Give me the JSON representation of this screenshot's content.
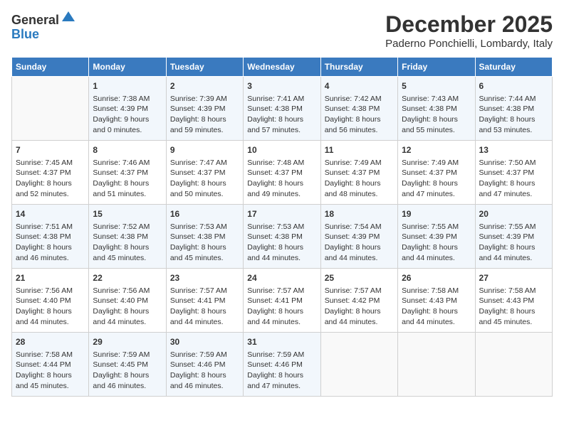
{
  "header": {
    "logo_line1": "General",
    "logo_line2": "Blue",
    "month_title": "December 2025",
    "subtitle": "Paderno Ponchielli, Lombardy, Italy"
  },
  "weekdays": [
    "Sunday",
    "Monday",
    "Tuesday",
    "Wednesday",
    "Thursday",
    "Friday",
    "Saturday"
  ],
  "weeks": [
    [
      {
        "day": "",
        "content": ""
      },
      {
        "day": "1",
        "content": "Sunrise: 7:38 AM\nSunset: 4:39 PM\nDaylight: 9 hours\nand 0 minutes."
      },
      {
        "day": "2",
        "content": "Sunrise: 7:39 AM\nSunset: 4:39 PM\nDaylight: 8 hours\nand 59 minutes."
      },
      {
        "day": "3",
        "content": "Sunrise: 7:41 AM\nSunset: 4:38 PM\nDaylight: 8 hours\nand 57 minutes."
      },
      {
        "day": "4",
        "content": "Sunrise: 7:42 AM\nSunset: 4:38 PM\nDaylight: 8 hours\nand 56 minutes."
      },
      {
        "day": "5",
        "content": "Sunrise: 7:43 AM\nSunset: 4:38 PM\nDaylight: 8 hours\nand 55 minutes."
      },
      {
        "day": "6",
        "content": "Sunrise: 7:44 AM\nSunset: 4:38 PM\nDaylight: 8 hours\nand 53 minutes."
      }
    ],
    [
      {
        "day": "7",
        "content": "Sunrise: 7:45 AM\nSunset: 4:37 PM\nDaylight: 8 hours\nand 52 minutes."
      },
      {
        "day": "8",
        "content": "Sunrise: 7:46 AM\nSunset: 4:37 PM\nDaylight: 8 hours\nand 51 minutes."
      },
      {
        "day": "9",
        "content": "Sunrise: 7:47 AM\nSunset: 4:37 PM\nDaylight: 8 hours\nand 50 minutes."
      },
      {
        "day": "10",
        "content": "Sunrise: 7:48 AM\nSunset: 4:37 PM\nDaylight: 8 hours\nand 49 minutes."
      },
      {
        "day": "11",
        "content": "Sunrise: 7:49 AM\nSunset: 4:37 PM\nDaylight: 8 hours\nand 48 minutes."
      },
      {
        "day": "12",
        "content": "Sunrise: 7:49 AM\nSunset: 4:37 PM\nDaylight: 8 hours\nand 47 minutes."
      },
      {
        "day": "13",
        "content": "Sunrise: 7:50 AM\nSunset: 4:37 PM\nDaylight: 8 hours\nand 47 minutes."
      }
    ],
    [
      {
        "day": "14",
        "content": "Sunrise: 7:51 AM\nSunset: 4:38 PM\nDaylight: 8 hours\nand 46 minutes."
      },
      {
        "day": "15",
        "content": "Sunrise: 7:52 AM\nSunset: 4:38 PM\nDaylight: 8 hours\nand 45 minutes."
      },
      {
        "day": "16",
        "content": "Sunrise: 7:53 AM\nSunset: 4:38 PM\nDaylight: 8 hours\nand 45 minutes."
      },
      {
        "day": "17",
        "content": "Sunrise: 7:53 AM\nSunset: 4:38 PM\nDaylight: 8 hours\nand 44 minutes."
      },
      {
        "day": "18",
        "content": "Sunrise: 7:54 AM\nSunset: 4:39 PM\nDaylight: 8 hours\nand 44 minutes."
      },
      {
        "day": "19",
        "content": "Sunrise: 7:55 AM\nSunset: 4:39 PM\nDaylight: 8 hours\nand 44 minutes."
      },
      {
        "day": "20",
        "content": "Sunrise: 7:55 AM\nSunset: 4:39 PM\nDaylight: 8 hours\nand 44 minutes."
      }
    ],
    [
      {
        "day": "21",
        "content": "Sunrise: 7:56 AM\nSunset: 4:40 PM\nDaylight: 8 hours\nand 44 minutes."
      },
      {
        "day": "22",
        "content": "Sunrise: 7:56 AM\nSunset: 4:40 PM\nDaylight: 8 hours\nand 44 minutes."
      },
      {
        "day": "23",
        "content": "Sunrise: 7:57 AM\nSunset: 4:41 PM\nDaylight: 8 hours\nand 44 minutes."
      },
      {
        "day": "24",
        "content": "Sunrise: 7:57 AM\nSunset: 4:41 PM\nDaylight: 8 hours\nand 44 minutes."
      },
      {
        "day": "25",
        "content": "Sunrise: 7:57 AM\nSunset: 4:42 PM\nDaylight: 8 hours\nand 44 minutes."
      },
      {
        "day": "26",
        "content": "Sunrise: 7:58 AM\nSunset: 4:43 PM\nDaylight: 8 hours\nand 44 minutes."
      },
      {
        "day": "27",
        "content": "Sunrise: 7:58 AM\nSunset: 4:43 PM\nDaylight: 8 hours\nand 45 minutes."
      }
    ],
    [
      {
        "day": "28",
        "content": "Sunrise: 7:58 AM\nSunset: 4:44 PM\nDaylight: 8 hours\nand 45 minutes."
      },
      {
        "day": "29",
        "content": "Sunrise: 7:59 AM\nSunset: 4:45 PM\nDaylight: 8 hours\nand 46 minutes."
      },
      {
        "day": "30",
        "content": "Sunrise: 7:59 AM\nSunset: 4:46 PM\nDaylight: 8 hours\nand 46 minutes."
      },
      {
        "day": "31",
        "content": "Sunrise: 7:59 AM\nSunset: 4:46 PM\nDaylight: 8 hours\nand 47 minutes."
      },
      {
        "day": "",
        "content": ""
      },
      {
        "day": "",
        "content": ""
      },
      {
        "day": "",
        "content": ""
      }
    ]
  ]
}
